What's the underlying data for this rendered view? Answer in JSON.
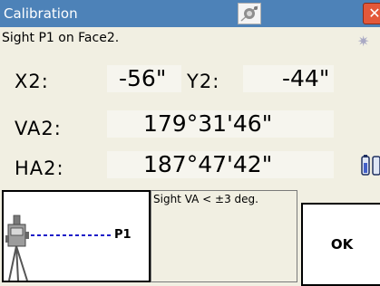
{
  "window": {
    "title": "Calibration",
    "title_icon": "prism-target-icon",
    "close_label": "✕"
  },
  "instruction": "Sight P1 on Face2.",
  "status_icon": "sun-icon",
  "readings": {
    "x2_label": "X2:",
    "x2_value": "-56\"",
    "y2_label": "Y2:",
    "y2_value": "-44\"",
    "va2_label": "VA2:",
    "va2_value": "179°31'46\"",
    "ha2_label": "HA2:",
    "ha2_value": "187°47'42\""
  },
  "battery_icon": "battery-icon",
  "diagram": {
    "instrument_icon": "total-station-icon",
    "target_label": "P1"
  },
  "note": "Sight VA < ±3 deg.",
  "ok_label": "OK",
  "colors": {
    "titlebar": "#4d82b8",
    "background": "#f1efe2",
    "sightline": "#1c1cc8"
  }
}
